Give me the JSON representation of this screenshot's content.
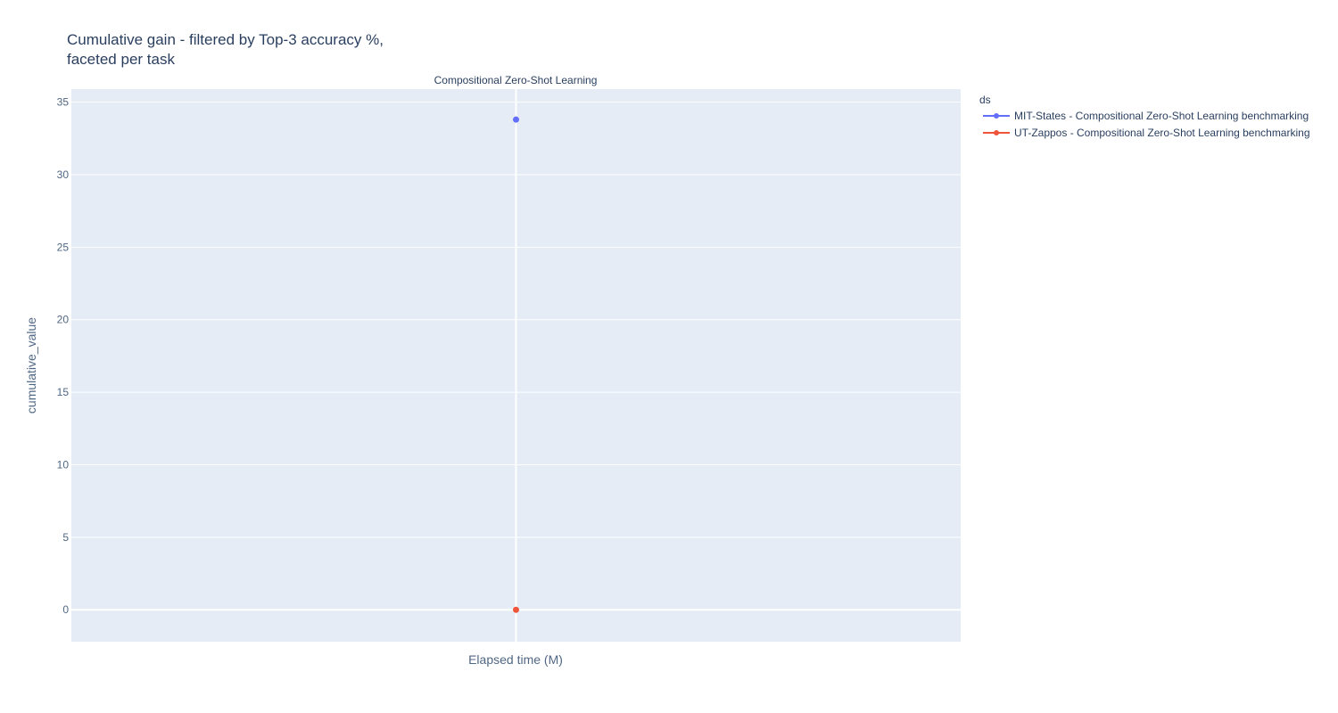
{
  "chart_data": {
    "type": "scatter",
    "title_lines": [
      "Cumulative gain - filtered by Top-3 accuracy %,",
      "faceted per task"
    ],
    "facet_title": "Compositional Zero-Shot Learning",
    "xlabel": "Elapsed time (M)",
    "ylabel": "cumulative_value",
    "ylim": [
      -2.2,
      35.9
    ],
    "yticks": [
      0,
      5,
      10,
      15,
      20,
      25,
      30,
      35
    ],
    "grid": true,
    "legend_title": "ds",
    "legend_position": "top-right",
    "series": [
      {
        "name": "MIT-States - Compositional Zero-Shot Learning benchmarking",
        "color": "#636efa",
        "points": [
          {
            "x": 0,
            "y": 33.8
          }
        ]
      },
      {
        "name": "UT-Zappos - Compositional Zero-Shot Learning benchmarking",
        "color": "#ef553b",
        "points": [
          {
            "x": 0,
            "y": 0
          }
        ]
      }
    ]
  }
}
